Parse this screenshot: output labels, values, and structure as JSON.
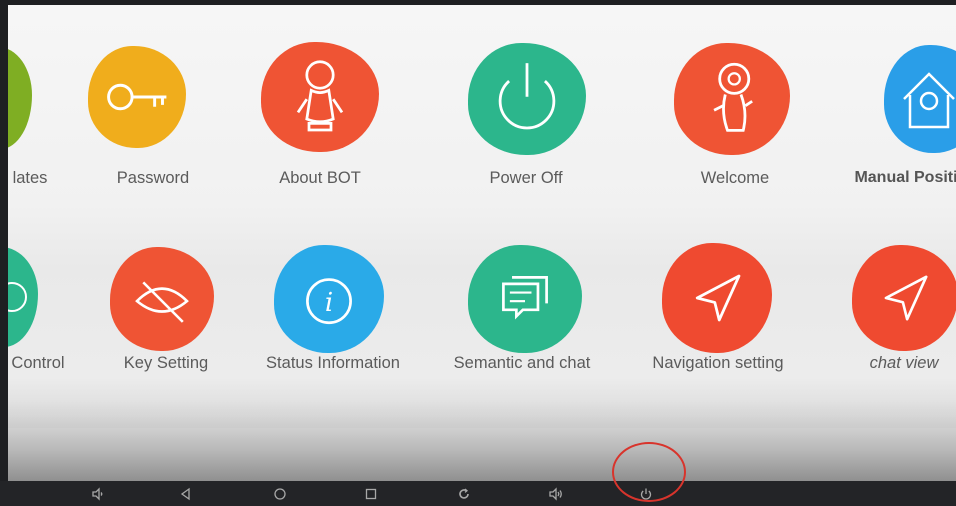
{
  "apps_row1": [
    {
      "label": "lates",
      "icon": "template-icon",
      "color": "#7fae23"
    },
    {
      "label": "Password",
      "icon": "key-icon",
      "color": "#f0ad1c"
    },
    {
      "label": "About BOT",
      "icon": "robot-icon",
      "color": "#ef5434"
    },
    {
      "label": "Power Off",
      "icon": "power-icon",
      "color": "#2cb68c"
    },
    {
      "label": "Welcome",
      "icon": "welcome-robot-icon",
      "color": "#ef5434"
    },
    {
      "label": "Manual Positi",
      "icon": "home-location-icon",
      "color": "#2a9ee8"
    }
  ],
  "apps_row2": [
    {
      "label": "Control",
      "icon": "remote-control-icon",
      "color": "#2cb68c"
    },
    {
      "label": "Key Setting",
      "icon": "eye-slash-icon",
      "color": "#ef5434"
    },
    {
      "label": "Status Information",
      "icon": "info-icon",
      "color": "#2aaae8"
    },
    {
      "label": "Semantic and chat",
      "icon": "chat-icon",
      "color": "#2cb68c"
    },
    {
      "label": "Navigation setting",
      "icon": "navigation-arrow-icon",
      "color": "#ef4a30"
    },
    {
      "label": "chat view",
      "icon": "navigation-arrow-icon",
      "color": "#ef4a30"
    }
  ],
  "navbar": {
    "buttons": [
      "volume-down-icon",
      "back-icon",
      "home-icon",
      "recents-icon",
      "refresh-icon",
      "volume-up-icon",
      "power-icon"
    ]
  },
  "colors": {
    "highlight": "#d8342c",
    "navbar": "#232427",
    "label_text": "#5b5b5b"
  }
}
